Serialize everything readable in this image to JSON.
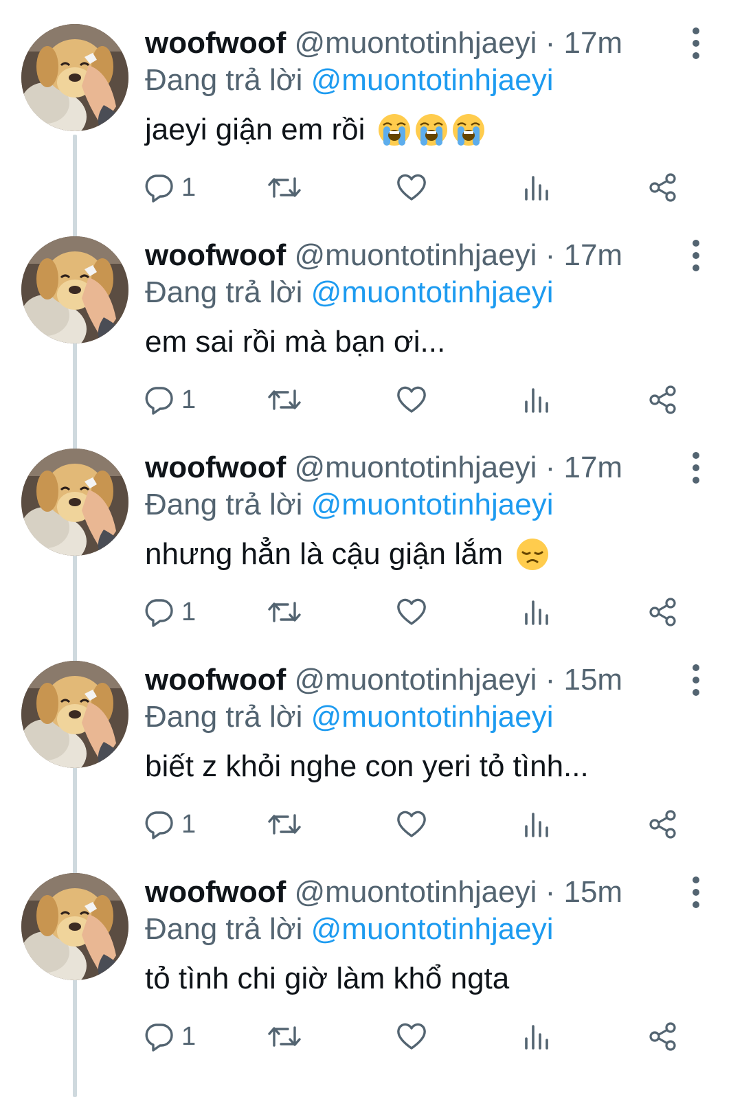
{
  "tweets": [
    {
      "display_name": "woofwoof",
      "handle": "@muontotinhjaeyi",
      "separator": "·",
      "time": "17m",
      "reply_prefix": "Đang trả lời",
      "reply_to": "@muontotinhjaeyi",
      "text": "jaeyi giận em rồi",
      "emojis": [
        "loudly-crying-face",
        "loudly-crying-face",
        "loudly-crying-face"
      ],
      "reply_count": "1"
    },
    {
      "display_name": "woofwoof",
      "handle": "@muontotinhjaeyi",
      "separator": "·",
      "time": "17m",
      "reply_prefix": "Đang trả lời",
      "reply_to": "@muontotinhjaeyi",
      "text": "em sai rồi mà bạn ơi...",
      "emojis": [],
      "reply_count": "1"
    },
    {
      "display_name": "woofwoof",
      "handle": "@muontotinhjaeyi",
      "separator": "·",
      "time": "17m",
      "reply_prefix": "Đang trả lời",
      "reply_to": "@muontotinhjaeyi",
      "text": "nhưng hẳn là cậu giận lắm",
      "emojis": [
        "disappointed-face"
      ],
      "reply_count": "1"
    },
    {
      "display_name": "woofwoof",
      "handle": "@muontotinhjaeyi",
      "separator": "·",
      "time": "15m",
      "reply_prefix": "Đang trả lời",
      "reply_to": "@muontotinhjaeyi",
      "text": "biết z khỏi nghe con yeri tỏ tình...",
      "emojis": [],
      "reply_count": "1"
    },
    {
      "display_name": "woofwoof",
      "handle": "@muontotinhjaeyi",
      "separator": "·",
      "time": "15m",
      "reply_prefix": "Đang trả lời",
      "reply_to": "@muontotinhjaeyi",
      "text": "tỏ tình chi giờ làm khổ ngta",
      "emojis": [],
      "reply_count": "1"
    }
  ],
  "icons": {
    "reply": "reply-icon",
    "retweet": "retweet-icon",
    "like": "heart-icon",
    "views": "views-icon",
    "share": "share-icon",
    "more": "more-vertical-icon"
  },
  "colors": {
    "text": "#0f1419",
    "secondary": "#536471",
    "mention": "#1d9bf0",
    "thread_line": "#cfd9de",
    "background": "#ffffff"
  }
}
